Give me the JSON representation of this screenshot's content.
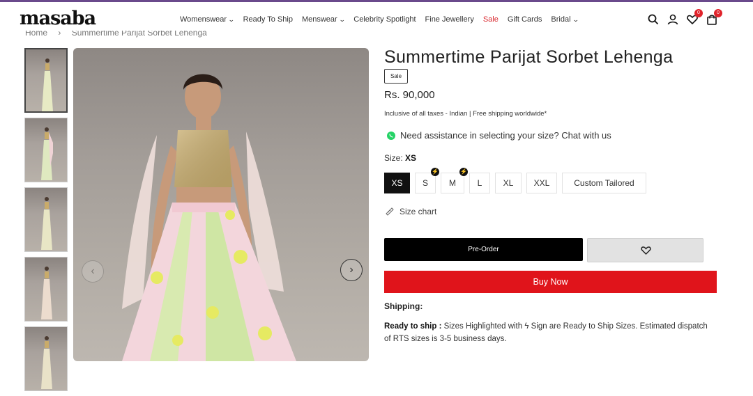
{
  "brand": {
    "logo": "masaba",
    "accent": "#6a4a8c"
  },
  "nav": {
    "items": [
      {
        "label": "Womenswear",
        "dropdown": true
      },
      {
        "label": "Ready To Ship",
        "dropdown": false
      },
      {
        "label": "Menswear",
        "dropdown": true
      },
      {
        "label": "Celebrity Spotlight",
        "dropdown": false
      },
      {
        "label": "Fine Jewellery",
        "dropdown": false
      },
      {
        "label": "Sale",
        "dropdown": false,
        "color": "#d9282f"
      },
      {
        "label": "Gift Cards",
        "dropdown": false
      },
      {
        "label": "Bridal",
        "dropdown": true
      }
    ],
    "icons": [
      "search-icon",
      "user-icon",
      "heart-icon",
      "bag-icon"
    ],
    "wishlist_count": "0",
    "cart_count": "0"
  },
  "breadcrumb": {
    "home": "Home",
    "sep": "›",
    "current": "Summertime Parijat Sorbet Lehenga"
  },
  "product": {
    "title": "Summertime Parijat Sorbet Lehenga",
    "tag": "Sale",
    "price": "Rs. 90,000",
    "taxes": "Inclusive of all taxes - Indian | Free shipping worldwide*",
    "assist": "Need assistance in selecting your size? Chat with us",
    "size_prefix": "Size:",
    "selected_size": "XS",
    "sizes": [
      {
        "label": "XS",
        "ready_to_ship": false
      },
      {
        "label": "S",
        "ready_to_ship": true
      },
      {
        "label": "M",
        "ready_to_ship": true
      },
      {
        "label": "L",
        "ready_to_ship": false
      },
      {
        "label": "XL",
        "ready_to_ship": false
      },
      {
        "label": "XXL",
        "ready_to_ship": false
      },
      {
        "label": "Custom Tailored",
        "ready_to_ship": false
      }
    ],
    "size_chart": "Size chart",
    "preorder": "Pre-Order",
    "buy_now": "Buy Now",
    "buy_color": "#e0141b",
    "shipping_heading": "Shipping:",
    "rts_label": "Ready to ship :",
    "rts_text_1": "Sizes Highlighted with",
    "rts_text_2": "Sign are Ready to Ship Sizes. Estimated dispatch of RTS sizes is 3-5 business days."
  },
  "gallery": {
    "thumbnail_count": 5
  }
}
